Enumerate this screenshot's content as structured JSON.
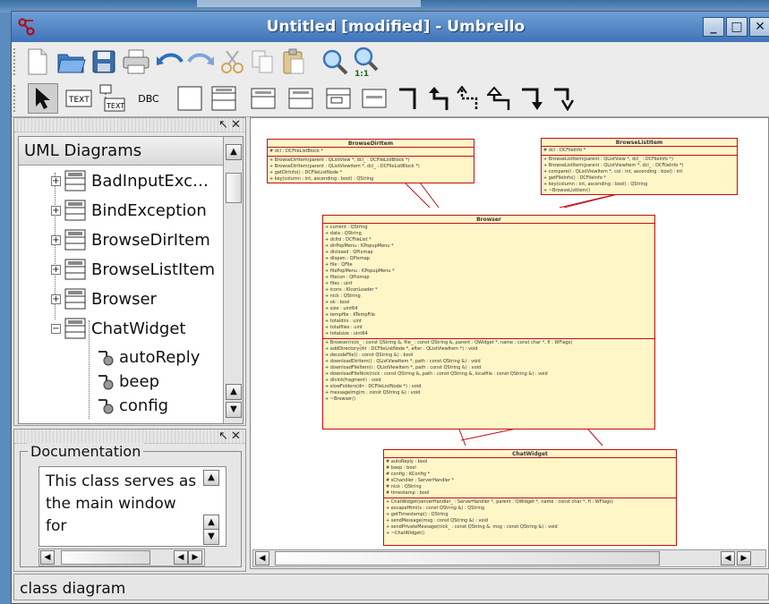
{
  "window": {
    "title": "Untitled [modified] - Umbrello",
    "minimize_glyph": "_",
    "maximize_glyph": "□",
    "close_glyph": "✕"
  },
  "toolbar_main": [
    "new-icon",
    "open-icon",
    "save-icon",
    "print-icon",
    "undo-icon",
    "redo-icon",
    "cut-icon",
    "copy-icon",
    "paste-icon",
    "zoom-in-icon",
    "zoom-100-icon"
  ],
  "toolbar_tools": {
    "text_label": "TEXT",
    "db_label": "DBC"
  },
  "tree": {
    "header": "UML Diagrams",
    "items": [
      {
        "label": "BadInputExc…",
        "kind": "class",
        "expander": "+"
      },
      {
        "label": "BindException",
        "kind": "class",
        "expander": "+"
      },
      {
        "label": "BrowseDirItem",
        "kind": "class",
        "expander": "+"
      },
      {
        "label": "BrowseListItem",
        "kind": "class",
        "expander": "+"
      },
      {
        "label": "Browser",
        "kind": "class",
        "expander": "+"
      },
      {
        "label": "ChatWidget",
        "kind": "class",
        "expander": "−"
      },
      {
        "label": "autoReply",
        "kind": "attribute"
      },
      {
        "label": "beep",
        "kind": "attribute"
      },
      {
        "label": "config",
        "kind": "attribute"
      }
    ]
  },
  "documentation": {
    "legend": "Documentation",
    "text": "This class serves as the main window for"
  },
  "canvas": {
    "classes": [
      {
        "name": "BrowseDirItem",
        "attrs": [
          "# dcl : DCFileListBlock *"
        ],
        "ops": [
          "+ BrowseDirItem(parent : QListView *, dcl_ : DCFileListBlock *)",
          "+ BrowseDirItem(parent : QListViewItem *, dcl_ : DCFileListBlock *)",
          "+ getDirInfo() : DCFileListNode *",
          "+ key(column : int, ascending : bool) : QString"
        ]
      },
      {
        "name": "BrowseListItem",
        "attrs": [
          "# dcl : DCFileInfo *"
        ],
        "ops": [
          "+ BrowseListItem(parent : QListView *, dcl_ : DCFileInfo *)",
          "+ BrowseListItem(parent : QListViewItem *, dcl_ : DCFileInfo *)",
          "+ compare(i : QListViewItem *, col : int, ascending : bool) : int",
          "+ getFileInfo() : DCFileInfo *",
          "+ key(column : int, ascending : bool) : QString",
          "+ ~BrowseListItem()"
        ]
      },
      {
        "name": "Browser",
        "attrs": [
          "+ current : QString",
          "+ data : QString",
          "+ dcltd : DCFileList *",
          "+ dirPopMenu : KPopupMenu *",
          "+ dlclosed : QPixmap",
          "+ dlopen : QPixmap",
          "+ file : QFile",
          "+ filePopMenu : KPopupMenu *",
          "+ filecon : QPixmap",
          "+ files : uint",
          "+ icons : KIconLoader *",
          "+ nick : QString",
          "+ ok : bool",
          "+ size : uint64",
          "+ tempfile : KTempFile",
          "+ totaldirs : uint",
          "+ totalfiles : uint",
          "+ totalsize : uint64"
        ],
        "ops": [
          "+ Browser(nick_ : const QString &, file_ : const QString &, parent : QWidget *, name : const char *, fl : WFlags)",
          "+ addDirectory(dir : DCFileListNode *, after : QListViewItem *) : void",
          "+ decodeFile() : const QString &) : bool",
          "+ downloadDirItem() : QListViewItem *, path : const QString &) : void",
          "+ downloadFileItem(i : QListViewItem *, path : const QString &) : void",
          "+ downloadFileNick(nick : const QString &, path : const QString &, localfile : const QString &) : void",
          "+ dlnlnt(fragment) : void",
          "+ slowFolders(dir : DCFileListNode *) : void",
          "+ messageImg(m : const QString &) : void",
          "+ ~Browser()"
        ]
      },
      {
        "name": "ChatWidget",
        "attrs": [
          "# autoReply : bool",
          "# beep : bool",
          "# config : KConfig *",
          "# sChandler : ServerHandler *",
          "# nick : QString",
          "# timestamp : bool"
        ],
        "ops": [
          "+ ChatWidget(serverHandler_ : ServerHandler *, parent : QWidget *, name : const char *, fl : WFlags)",
          "+ escapeHtml(s : const QString &) : QString",
          "+ getTimestamp() : QString",
          "+ sendMessage(msg : const QString &) : void",
          "+ sendPrivateMessage(nick_ : const QString &, msg : const QString &) : void",
          "+ ~ChatWidget()"
        ]
      }
    ]
  },
  "status": "class diagram"
}
